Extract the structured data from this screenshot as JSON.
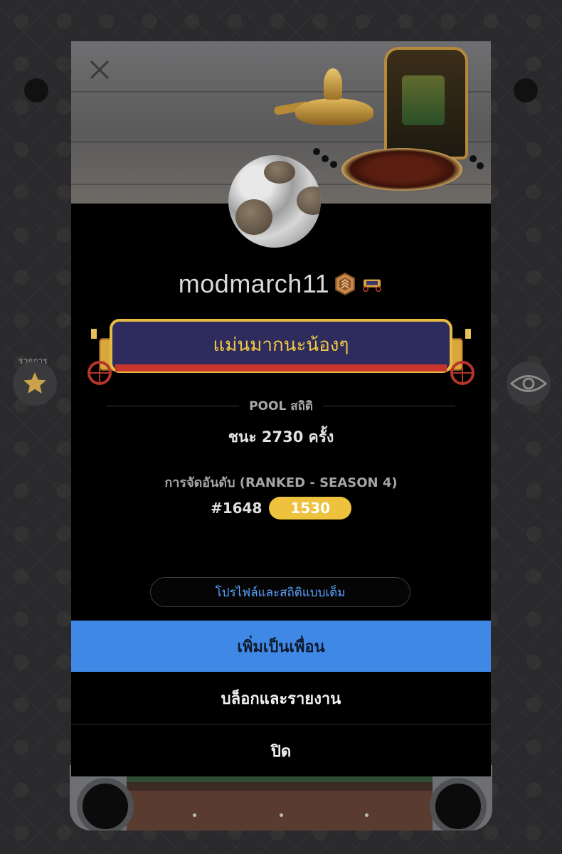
{
  "sidebar": {
    "list_label": "รายการ"
  },
  "profile": {
    "username": "modmarch11",
    "title": "แม่นมากนะน้องๆ"
  },
  "stats": {
    "section_label": "POOL สถิติ",
    "wins_text": "ชนะ 2730 ครั้ง",
    "ranking_label": "การจัดอันดับ (RANKED - SEASON 4)",
    "rank_number": "#1648",
    "rank_points": "1530"
  },
  "buttons": {
    "full_profile": "โปรไฟล์และสถิติแบบเต็ม",
    "add_friend": "เพิ่มเป็นเพื่อน",
    "block_report": "บล็อกและรายงาน",
    "close": "ปิด"
  },
  "colors": {
    "accent_blue": "#4088e6",
    "link_blue": "#5aa2ff",
    "gold": "#eec23c",
    "title_gold": "#f0c844",
    "modal_bg": "#000000"
  },
  "icons": [
    "close-icon",
    "star-icon",
    "eye-icon",
    "rank-badge-icon",
    "carriage-badge-icon"
  ]
}
